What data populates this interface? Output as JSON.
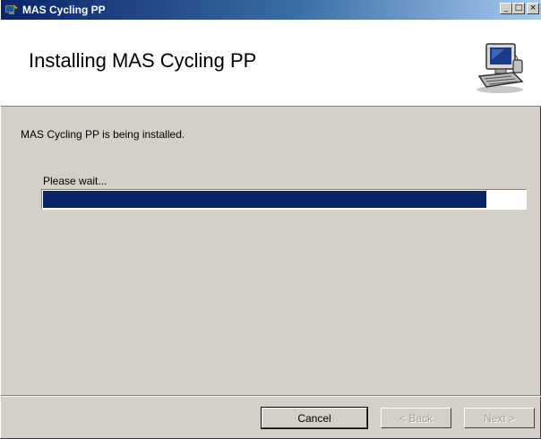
{
  "window": {
    "title": "MAS Cycling PP",
    "controls": {
      "minimize": "_",
      "maximize": "□",
      "close": "×"
    }
  },
  "banner": {
    "title": "Installing MAS Cycling PP",
    "icon": "computer-setup-icon"
  },
  "body": {
    "status": "MAS Cycling PP is being installed.",
    "wait_label": "Please wait...",
    "progress_fraction": 0.92
  },
  "buttons": {
    "cancel": "Cancel",
    "back": "< Back",
    "next": "Next >"
  },
  "colors": {
    "title_bar_start": "#0a246a",
    "title_bar_end": "#a6caf0",
    "progress_fill": "#0a246a",
    "dialog_face": "#d4d0c8"
  }
}
